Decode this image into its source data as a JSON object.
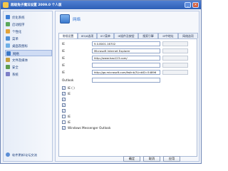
{
  "window": {
    "title": "超级兔子魔法设置 2009.0 个人版"
  },
  "sidebar": {
    "items": [
      {
        "label": "优化系统",
        "icon": "system-icon",
        "color": "#3d7fd6"
      },
      {
        "label": "启动程序",
        "icon": "startup-icon",
        "color": "#5aa85a"
      },
      {
        "label": "个性化",
        "icon": "personalize-icon",
        "color": "#e2a33a"
      },
      {
        "label": "菜单",
        "icon": "menu-icon",
        "color": "#4c8fd8"
      },
      {
        "label": "桌面及图标",
        "icon": "desktop-icon",
        "color": "#6fb0e6"
      },
      {
        "label": "网络",
        "icon": "network-icon",
        "color": "#3b78c8"
      },
      {
        "label": "文件及媒体",
        "icon": "file-media-icon",
        "color": "#c8a040"
      },
      {
        "label": "安全",
        "icon": "security-icon",
        "color": "#5f9d4f"
      },
      {
        "label": "系统",
        "icon": "system-settings-icon",
        "color": "#7c7fc8"
      }
    ],
    "active_index": 5,
    "bottom_link": "软件更新/论坛交流"
  },
  "main": {
    "title": "网络",
    "tabs": [
      "常规设置",
      "IE5/6选项",
      "IE7菜单",
      "IE插件及按钮",
      "搜索引擎",
      "IE中地址",
      "网络选项"
    ],
    "active_tab": 0,
    "fields": [
      {
        "label": "IE",
        "value": "9.0.8001.16702"
      },
      {
        "label": "IE",
        "value": "Microsoft Internet Explorer"
      },
      {
        "label": "IE",
        "value": "http://www.hao123.com/"
      },
      {
        "label": "IE",
        "value": ""
      },
      {
        "label": "IE",
        "value": "http://go.microsoft.com/fwlink/?LinkID=54896"
      }
    ],
    "outlook_label": "Outlook",
    "checkboxes": [
      {
        "label": "IE   (     )",
        "checked": true
      },
      {
        "label": "IE",
        "checked": true
      },
      {
        "label": "",
        "checked": true
      },
      {
        "label": "",
        "checked": true
      },
      {
        "label": "",
        "checked": true
      },
      {
        "label": "IE",
        "checked": false
      },
      {
        "label": "IE",
        "checked": false
      },
      {
        "label": "Windows Messenger  Outlook",
        "checked": true
      }
    ]
  },
  "footer": {
    "ok": "确定",
    "cancel": "取消",
    "apply": "应用"
  }
}
